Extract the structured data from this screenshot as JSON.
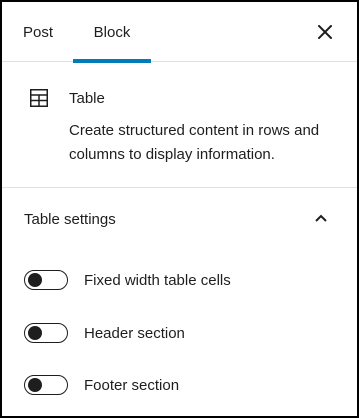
{
  "tabs": {
    "post_label": "Post",
    "block_label": "Block",
    "active": "Block"
  },
  "close_icon": "close-icon",
  "block": {
    "icon": "table-icon",
    "title": "Table",
    "description": "Create structured content in rows and columns to display information."
  },
  "settings": {
    "title": "Table settings",
    "expanded": true,
    "toggles": [
      {
        "label": "Fixed width table cells",
        "checked": false
      },
      {
        "label": "Header section",
        "checked": false
      },
      {
        "label": "Footer section",
        "checked": false
      }
    ]
  },
  "colors": {
    "accent": "#007cba",
    "text": "#1e1e1e",
    "divider": "#e0e0e0"
  }
}
